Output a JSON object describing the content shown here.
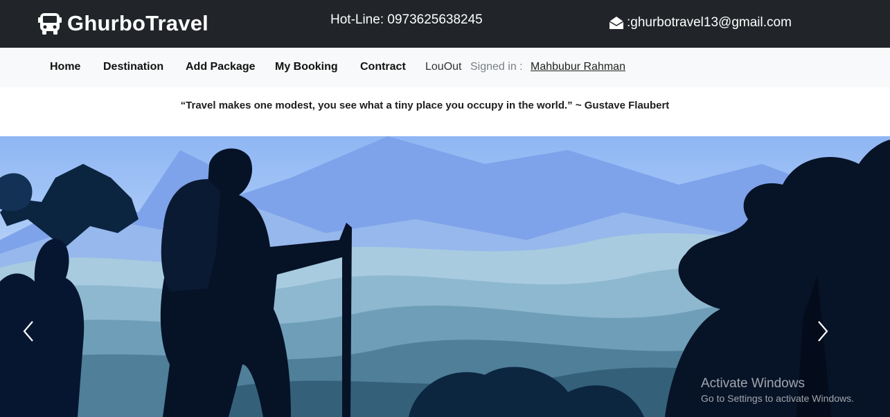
{
  "header": {
    "brand": "GhurboTravel",
    "brand_icon": "bus-icon",
    "hotline": "Hot-Line: 0973625638245",
    "email_icon": "envelope-open-icon",
    "email": ":ghurbotravel13@gmail.com",
    "background": "#212529"
  },
  "nav": {
    "items": [
      {
        "label": "Home"
      },
      {
        "label": "Destination"
      },
      {
        "label": "Add Package"
      },
      {
        "label": "My Booking"
      },
      {
        "label": "Contract"
      }
    ],
    "logout": "LouOut",
    "signed_in_label": "Signed in :",
    "user": "Mahbubur Rahman",
    "background": "#f8f9fa"
  },
  "quote": "“Travel makes one modest, you see what a tiny place you occupy in the world.” ~ Gustave Flaubert",
  "carousel": {
    "prev_icon": "chevron-left-icon",
    "next_icon": "chevron-right-icon",
    "sky_color": "#9dc2f5",
    "silhouette_color": "#061226"
  },
  "watermark": {
    "title": "Activate Windows",
    "subtitle": "Go to Settings to activate Windows."
  }
}
